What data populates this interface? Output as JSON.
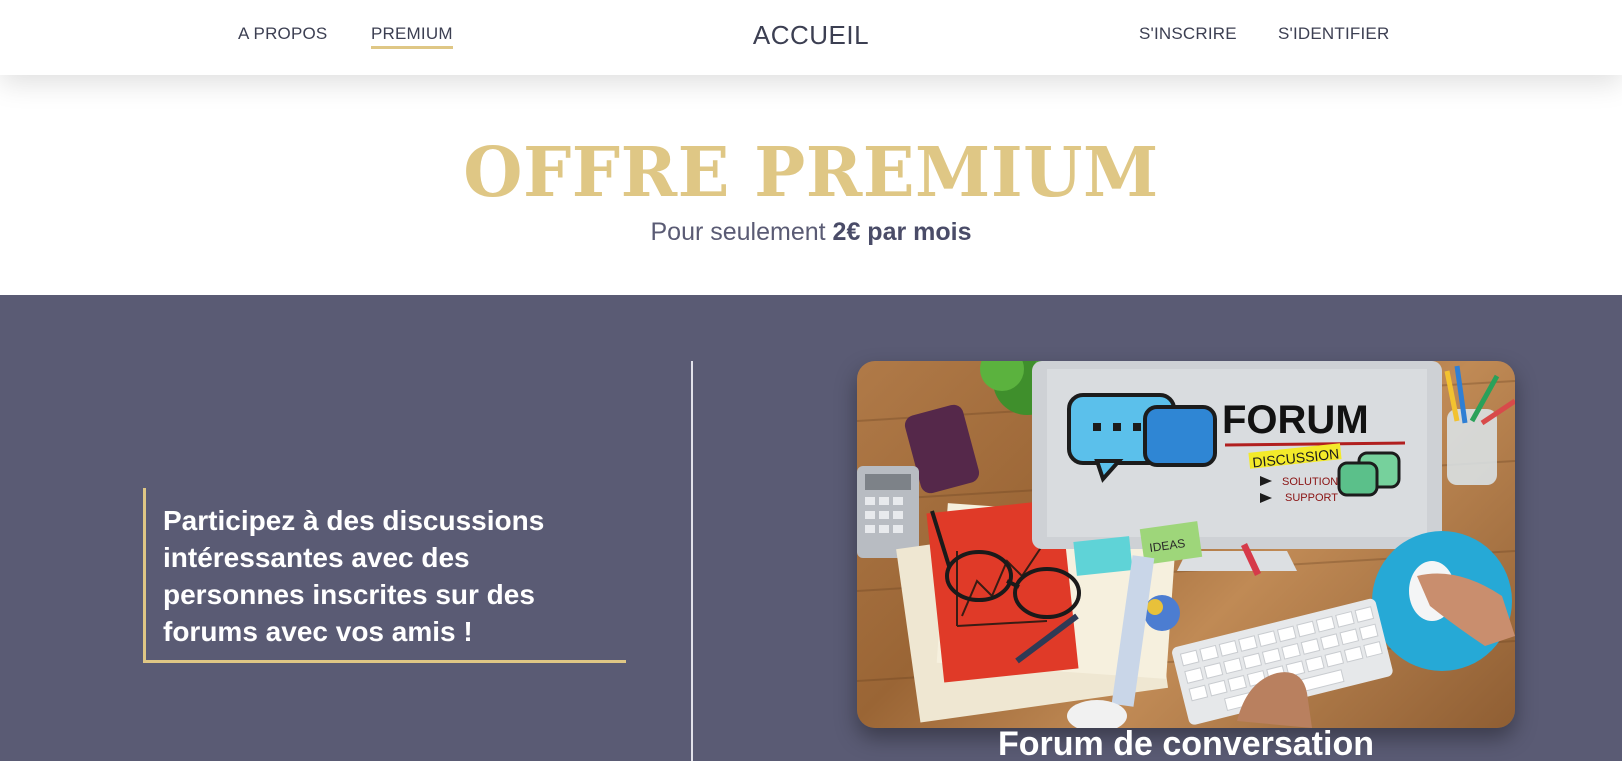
{
  "nav": {
    "about": "A PROPOS",
    "premium": "PREMIUM",
    "home": "ACCUEIL",
    "signup": "S'INSCRIRE",
    "signin": "S'IDENTIFIER"
  },
  "hero": {
    "title": "OFFRE PREMIUM",
    "subtitle_prefix": "Pour seulement ",
    "subtitle_price": "2€ par mois"
  },
  "feature": {
    "quote": "Participez à des discussions intéressantes avec des personnes inscrites sur des forums avec vos amis !",
    "caption_partial": "Forum de conversation"
  },
  "image": {
    "screen_title": "FORUM",
    "tag_discussion": "DISCUSSION",
    "tag_solution": "SOLUTION",
    "tag_support": "SUPPORT",
    "note_ideas": "IDEAS"
  },
  "colors": {
    "accent_gold": "#dfc785",
    "section_bg": "#5a5b74",
    "nav_text": "#3c3f52"
  }
}
